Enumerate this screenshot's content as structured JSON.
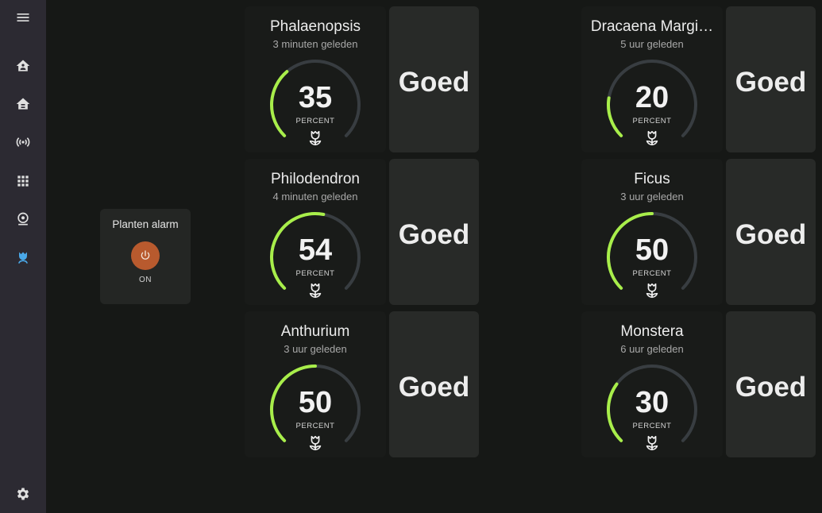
{
  "sidebar": {
    "items": [
      {
        "icon": "menu-icon"
      },
      {
        "icon": "home-icon"
      },
      {
        "icon": "house-icon"
      },
      {
        "icon": "broadcast-icon"
      },
      {
        "icon": "grid-icon"
      },
      {
        "icon": "webcam-icon"
      },
      {
        "icon": "flower-icon",
        "active": true
      },
      {
        "icon": "gear-icon"
      }
    ],
    "active_color": "#4aa8e8"
  },
  "alarm": {
    "title": "Planten alarm",
    "state": "ON",
    "button_color": "#b85a2e"
  },
  "gauge_color": "#a8ee4a",
  "gauge_track_color": "#383d41",
  "plants": [
    {
      "name": "Phalaenopsis",
      "updated": "3 minuten geleden",
      "value": 35,
      "unit": "PERCENT",
      "status": "Goed"
    },
    {
      "name": "Philodendron",
      "updated": "4 minuten geleden",
      "value": 54,
      "unit": "PERCENT",
      "status": "Goed"
    },
    {
      "name": "Anthurium",
      "updated": "3 uur geleden",
      "value": 50,
      "unit": "PERCENT",
      "status": "Goed"
    },
    {
      "name": "Dracaena Margi…",
      "updated": "5 uur geleden",
      "value": 20,
      "unit": "PERCENT",
      "status": "Goed"
    },
    {
      "name": "Ficus",
      "updated": "3 uur geleden",
      "value": 50,
      "unit": "PERCENT",
      "status": "Goed"
    },
    {
      "name": "Monstera",
      "updated": "6 uur geleden",
      "value": 30,
      "unit": "PERCENT",
      "status": "Goed"
    }
  ]
}
